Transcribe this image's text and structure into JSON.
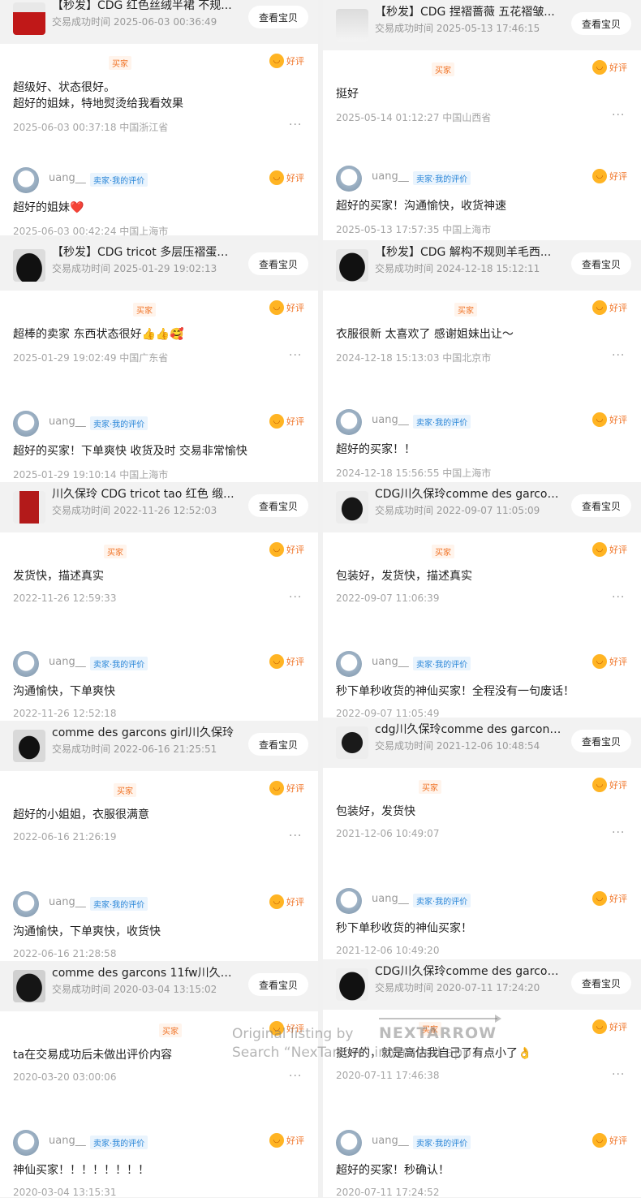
{
  "view_button_label": "查看宝贝",
  "buyer_tag": "买家",
  "seller_tag": "卖家·我的评价",
  "good_label": "好评",
  "more_glyph": "···",
  "seller_name": "uang__",
  "watermark": {
    "line1": "Original listing by",
    "brand": "NEXTARROW",
    "line2": "Search “NexTarrow” in Grailed app."
  },
  "left": [
    {
      "order": {
        "title": "【秒发】CDG 红色丝绒半裙 不规...",
        "time": "交易成功时间 2025-06-03 00:36:49",
        "thumb": "red-skirt"
      },
      "buyer": {
        "text": "超级好、状态很好。\n超好的姐妹，特地熨烫给我看效果",
        "meta": "2025-06-03 00:37:18   中国浙江省"
      },
      "seller": {
        "text": "超好的姐妹❤️",
        "meta": "2025-06-03 00:42:24   中国上海市"
      }
    },
    {
      "order": {
        "title": "【秒发】CDG tricot 多层压褶蛋糕...",
        "time": "交易成功时间 2025-01-29 19:02:13",
        "thumb": "black-skirt"
      },
      "buyer": {
        "text": "超棒的卖家 东西状态很好👍👍🥰",
        "meta": "2025-01-29 19:02:49   中国广东省"
      },
      "seller": {
        "text": "超好的买家！下单爽快 收货及时 交易非常愉快",
        "meta": "2025-01-29 19:10:14   中国上海市"
      }
    },
    {
      "order": {
        "title": "川久保玲 CDG tricot tao 红色 缎...",
        "time": "交易成功时间 2022-11-26 12:52:03",
        "thumb": "red-dress"
      },
      "buyer": {
        "text": "发货快，描述真实",
        "meta": "2022-11-26 12:59:33"
      },
      "seller": {
        "text": "沟通愉快，下单爽快",
        "meta": "2022-11-26 12:52:18"
      }
    },
    {
      "order": {
        "title": "comme des garcons girl川久保玲",
        "time": "交易成功时间 2022-06-16 21:25:51",
        "thumb": "black-outfit"
      },
      "buyer": {
        "text": "超好的小姐姐，衣服很满意",
        "meta": "2022-06-16 21:26:19"
      },
      "seller": {
        "text": "沟通愉快，下单爽快，收货快",
        "meta": "2022-06-16 21:28:58"
      }
    },
    {
      "order": {
        "title": "comme des garcons 11fw川久保...",
        "time": "交易成功时间 2020-03-04 13:15:02",
        "thumb": "black-jacket"
      },
      "buyer": {
        "text": "ta在交易成功后未做出评价内容",
        "meta": "2020-03-20 03:00:06"
      },
      "seller": {
        "text": "神仙买家！！！！！！！！",
        "meta": "2020-03-04 13:15:31"
      }
    }
  ],
  "right": [
    {
      "order": {
        "title": "【秒发】CDG 捏褶蔷薇 五花褶皱...",
        "time": "交易成功时间 2025-05-13 17:46:15",
        "thumb": "white-top"
      },
      "buyer": {
        "text": "挺好",
        "meta": "2025-05-14 01:12:27   中国山西省"
      },
      "seller": {
        "text": "超好的买家！沟通愉快，收货神速",
        "meta": "2025-05-13 17:57:35   中国上海市"
      }
    },
    {
      "order": {
        "title": "【秒发】CDG 解构不规则羊毛西...",
        "time": "交易成功时间 2024-12-18 15:12:11",
        "thumb": "black-blazer"
      },
      "buyer": {
        "text": "衣服很新 太喜欢了 感谢姐妹出让～",
        "meta": "2024-12-18 15:13:03   中国北京市"
      },
      "seller": {
        "text": "超好的买家！！",
        "meta": "2024-12-18 15:56:55   中国上海市"
      }
    },
    {
      "order": {
        "title": "CDG川久保玲comme des garcon...",
        "time": "交易成功时间 2022-09-07 11:05:09",
        "thumb": "black-coat"
      },
      "buyer": {
        "text": "包装好，发货快，描述真实",
        "meta": "2022-09-07 11:06:39"
      },
      "seller": {
        "text": "秒下单秒收货的神仙买家！全程没有一句废话！",
        "meta": "2022-09-07 11:05:49"
      }
    },
    {
      "order": {
        "title": "cdg川久保玲comme des garcons...",
        "time": "交易成功时间 2021-12-06 10:48:54",
        "thumb": "black-top"
      },
      "buyer": {
        "text": "包装好，发货快",
        "meta": "2021-12-06 10:49:07"
      },
      "seller": {
        "text": "秒下单秒收货的神仙买家！",
        "meta": "2021-12-06 10:49:20"
      }
    },
    {
      "order": {
        "title": "CDG川久保玲comme des garcon...",
        "time": "交易成功时间 2020-07-11 17:24:20",
        "thumb": "black-sweater"
      },
      "buyer": {
        "text": "挺好的，就是高估我自己了有点小了👌",
        "meta": "2020-07-11 17:46:38"
      },
      "seller": {
        "text": "超好的买家！秒确认！",
        "meta": "2020-07-11 17:24:52"
      }
    }
  ]
}
